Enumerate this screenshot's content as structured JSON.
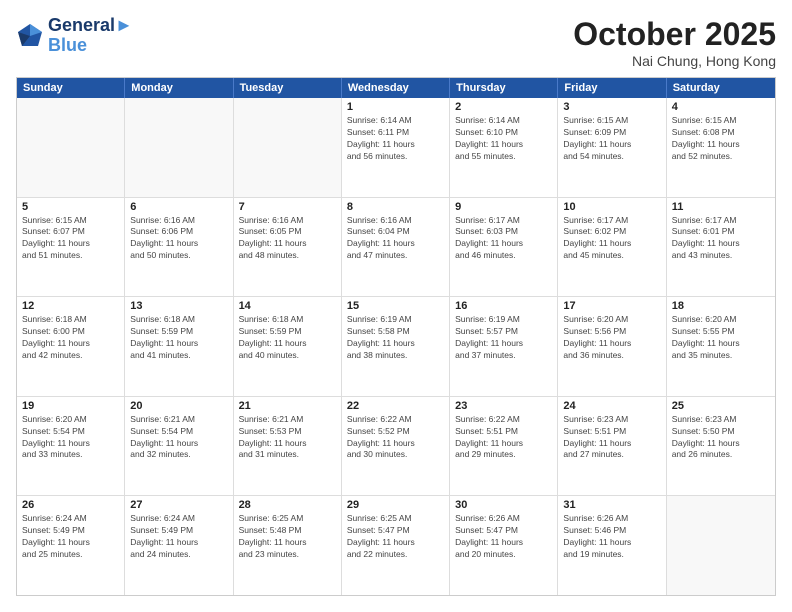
{
  "header": {
    "logo_line1": "General",
    "logo_line2": "Blue",
    "month_title": "October 2025",
    "subtitle": "Nai Chung, Hong Kong"
  },
  "day_names": [
    "Sunday",
    "Monday",
    "Tuesday",
    "Wednesday",
    "Thursday",
    "Friday",
    "Saturday"
  ],
  "weeks": [
    [
      {
        "date": "",
        "info": ""
      },
      {
        "date": "",
        "info": ""
      },
      {
        "date": "",
        "info": ""
      },
      {
        "date": "1",
        "info": "Sunrise: 6:14 AM\nSunset: 6:11 PM\nDaylight: 11 hours\nand 56 minutes."
      },
      {
        "date": "2",
        "info": "Sunrise: 6:14 AM\nSunset: 6:10 PM\nDaylight: 11 hours\nand 55 minutes."
      },
      {
        "date": "3",
        "info": "Sunrise: 6:15 AM\nSunset: 6:09 PM\nDaylight: 11 hours\nand 54 minutes."
      },
      {
        "date": "4",
        "info": "Sunrise: 6:15 AM\nSunset: 6:08 PM\nDaylight: 11 hours\nand 52 minutes."
      }
    ],
    [
      {
        "date": "5",
        "info": "Sunrise: 6:15 AM\nSunset: 6:07 PM\nDaylight: 11 hours\nand 51 minutes."
      },
      {
        "date": "6",
        "info": "Sunrise: 6:16 AM\nSunset: 6:06 PM\nDaylight: 11 hours\nand 50 minutes."
      },
      {
        "date": "7",
        "info": "Sunrise: 6:16 AM\nSunset: 6:05 PM\nDaylight: 11 hours\nand 48 minutes."
      },
      {
        "date": "8",
        "info": "Sunrise: 6:16 AM\nSunset: 6:04 PM\nDaylight: 11 hours\nand 47 minutes."
      },
      {
        "date": "9",
        "info": "Sunrise: 6:17 AM\nSunset: 6:03 PM\nDaylight: 11 hours\nand 46 minutes."
      },
      {
        "date": "10",
        "info": "Sunrise: 6:17 AM\nSunset: 6:02 PM\nDaylight: 11 hours\nand 45 minutes."
      },
      {
        "date": "11",
        "info": "Sunrise: 6:17 AM\nSunset: 6:01 PM\nDaylight: 11 hours\nand 43 minutes."
      }
    ],
    [
      {
        "date": "12",
        "info": "Sunrise: 6:18 AM\nSunset: 6:00 PM\nDaylight: 11 hours\nand 42 minutes."
      },
      {
        "date": "13",
        "info": "Sunrise: 6:18 AM\nSunset: 5:59 PM\nDaylight: 11 hours\nand 41 minutes."
      },
      {
        "date": "14",
        "info": "Sunrise: 6:18 AM\nSunset: 5:59 PM\nDaylight: 11 hours\nand 40 minutes."
      },
      {
        "date": "15",
        "info": "Sunrise: 6:19 AM\nSunset: 5:58 PM\nDaylight: 11 hours\nand 38 minutes."
      },
      {
        "date": "16",
        "info": "Sunrise: 6:19 AM\nSunset: 5:57 PM\nDaylight: 11 hours\nand 37 minutes."
      },
      {
        "date": "17",
        "info": "Sunrise: 6:20 AM\nSunset: 5:56 PM\nDaylight: 11 hours\nand 36 minutes."
      },
      {
        "date": "18",
        "info": "Sunrise: 6:20 AM\nSunset: 5:55 PM\nDaylight: 11 hours\nand 35 minutes."
      }
    ],
    [
      {
        "date": "19",
        "info": "Sunrise: 6:20 AM\nSunset: 5:54 PM\nDaylight: 11 hours\nand 33 minutes."
      },
      {
        "date": "20",
        "info": "Sunrise: 6:21 AM\nSunset: 5:54 PM\nDaylight: 11 hours\nand 32 minutes."
      },
      {
        "date": "21",
        "info": "Sunrise: 6:21 AM\nSunset: 5:53 PM\nDaylight: 11 hours\nand 31 minutes."
      },
      {
        "date": "22",
        "info": "Sunrise: 6:22 AM\nSunset: 5:52 PM\nDaylight: 11 hours\nand 30 minutes."
      },
      {
        "date": "23",
        "info": "Sunrise: 6:22 AM\nSunset: 5:51 PM\nDaylight: 11 hours\nand 29 minutes."
      },
      {
        "date": "24",
        "info": "Sunrise: 6:23 AM\nSunset: 5:51 PM\nDaylight: 11 hours\nand 27 minutes."
      },
      {
        "date": "25",
        "info": "Sunrise: 6:23 AM\nSunset: 5:50 PM\nDaylight: 11 hours\nand 26 minutes."
      }
    ],
    [
      {
        "date": "26",
        "info": "Sunrise: 6:24 AM\nSunset: 5:49 PM\nDaylight: 11 hours\nand 25 minutes."
      },
      {
        "date": "27",
        "info": "Sunrise: 6:24 AM\nSunset: 5:49 PM\nDaylight: 11 hours\nand 24 minutes."
      },
      {
        "date": "28",
        "info": "Sunrise: 6:25 AM\nSunset: 5:48 PM\nDaylight: 11 hours\nand 23 minutes."
      },
      {
        "date": "29",
        "info": "Sunrise: 6:25 AM\nSunset: 5:47 PM\nDaylight: 11 hours\nand 22 minutes."
      },
      {
        "date": "30",
        "info": "Sunrise: 6:26 AM\nSunset: 5:47 PM\nDaylight: 11 hours\nand 20 minutes."
      },
      {
        "date": "31",
        "info": "Sunrise: 6:26 AM\nSunset: 5:46 PM\nDaylight: 11 hours\nand 19 minutes."
      },
      {
        "date": "",
        "info": ""
      }
    ]
  ]
}
